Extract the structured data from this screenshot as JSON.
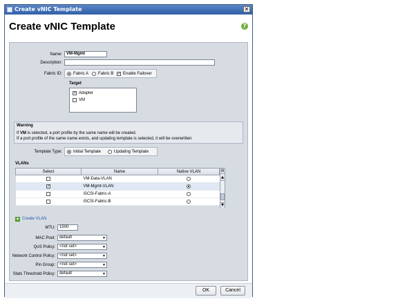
{
  "window": {
    "title": "Create vNIC Template",
    "close_glyph": "✕"
  },
  "header": {
    "title": "Create vNIC Template",
    "help_glyph": "?"
  },
  "form": {
    "name_label": "Name:",
    "name_value": "VM-Mgmt",
    "description_label": "Description:",
    "description_value": "",
    "fabric_label": "Fabric ID:",
    "fabric_options": [
      "Fabric A",
      "Fabric B"
    ],
    "fabric_selected": "Fabric A",
    "failover_label": "Enable Failover",
    "failover_checked": true,
    "target": {
      "title": "Target",
      "items": [
        {
          "label": "Adapter",
          "checked": true
        },
        {
          "label": "VM",
          "checked": false
        }
      ]
    },
    "warning": {
      "title": "Warning",
      "line1_prefix": "If ",
      "line1_bold": "VM",
      "line1_rest": " is selected, a port profile by the same name will be created.",
      "line2": "If a port profile of the same name exists, and updating template is selected, it will be overwritten"
    },
    "template_type_label": "Template Type:",
    "template_type_options": [
      "Initial Template",
      "Updating Template"
    ],
    "template_type_selected": "Initial Template",
    "vlans": {
      "title": "VLANs",
      "columns": [
        "Select",
        "Name",
        "Native VLAN"
      ],
      "rows": [
        {
          "select": false,
          "name": "VM-Data-VLAN",
          "native": false
        },
        {
          "select": true,
          "name": "VM-Mgmt-VLAN",
          "native": true
        },
        {
          "select": false,
          "name": "iSCSI-Fabric-A",
          "native": false
        },
        {
          "select": false,
          "name": "iSCSI-Fabric-B",
          "native": false
        }
      ]
    },
    "create_vlan_label": "Create VLAN",
    "mtu_label": "MTU:",
    "mtu_value": "1500",
    "mac_pool_label": "MAC Pool:",
    "mac_pool_value": "default",
    "qos_label": "QoS Policy:",
    "qos_value": "<not set>",
    "ncp_label": "Network Control Policy:",
    "ncp_value": "<not set>",
    "pin_group_label": "Pin Group:",
    "pin_group_value": "<not set>",
    "stats_label": "Stats Threshold Policy:",
    "stats_value": "default"
  },
  "footer": {
    "ok_label": "OK",
    "cancel_label": "Cancel"
  },
  "icons": {
    "check_glyph": "✓",
    "dropdown_glyph": "▼",
    "scroll_up_glyph": "▲",
    "scroll_down_glyph": "▼",
    "column_chooser_glyph": "▤",
    "add_glyph": "+"
  },
  "colors": {
    "title_bar": "#2f5fa8",
    "panel": "#d7dce3",
    "link": "#1f5ba8",
    "help": "#6fae3e",
    "add_icon": "#4e9a2b"
  }
}
